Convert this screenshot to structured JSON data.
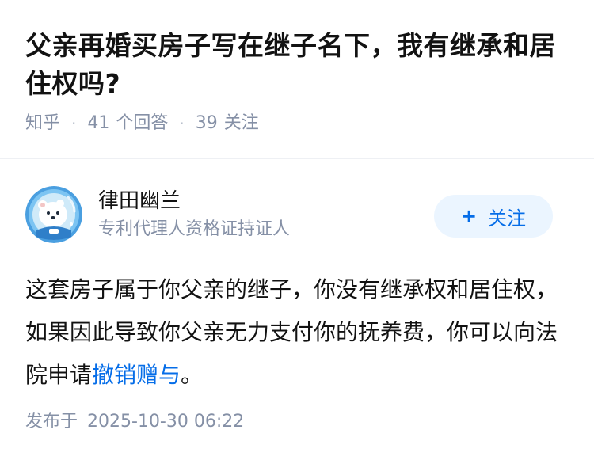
{
  "question": {
    "title": "父亲再婚买房子写在继子名下，我有继承和居住权吗?",
    "source": "知乎",
    "separator": "·",
    "answers_count": "41",
    "answers_label": "个回答",
    "followers_count": "39",
    "followers_label": "关注"
  },
  "answer": {
    "author": {
      "name": "律田幽兰",
      "headline": "专利代理人资格证持证人",
      "avatar_icon": "polar-bear-astronaut-avatar-icon"
    },
    "follow_button": {
      "plus": "+",
      "label": "关注"
    },
    "content": {
      "text_before_link": "这套房子属于你父亲的继子，你没有继承权和居住权，如果因此导致你父亲无力支付你的抚养费，你可以向法院申请",
      "link_text": "撤销赠与",
      "text_after_link": "。"
    },
    "publish": {
      "label": "发布于",
      "datetime": "2025-10-30 06:22"
    }
  },
  "colors": {
    "accent": "#056de8",
    "follow_bg": "#ebf5ff",
    "meta_text": "#8590a6",
    "title_text": "#121212"
  }
}
